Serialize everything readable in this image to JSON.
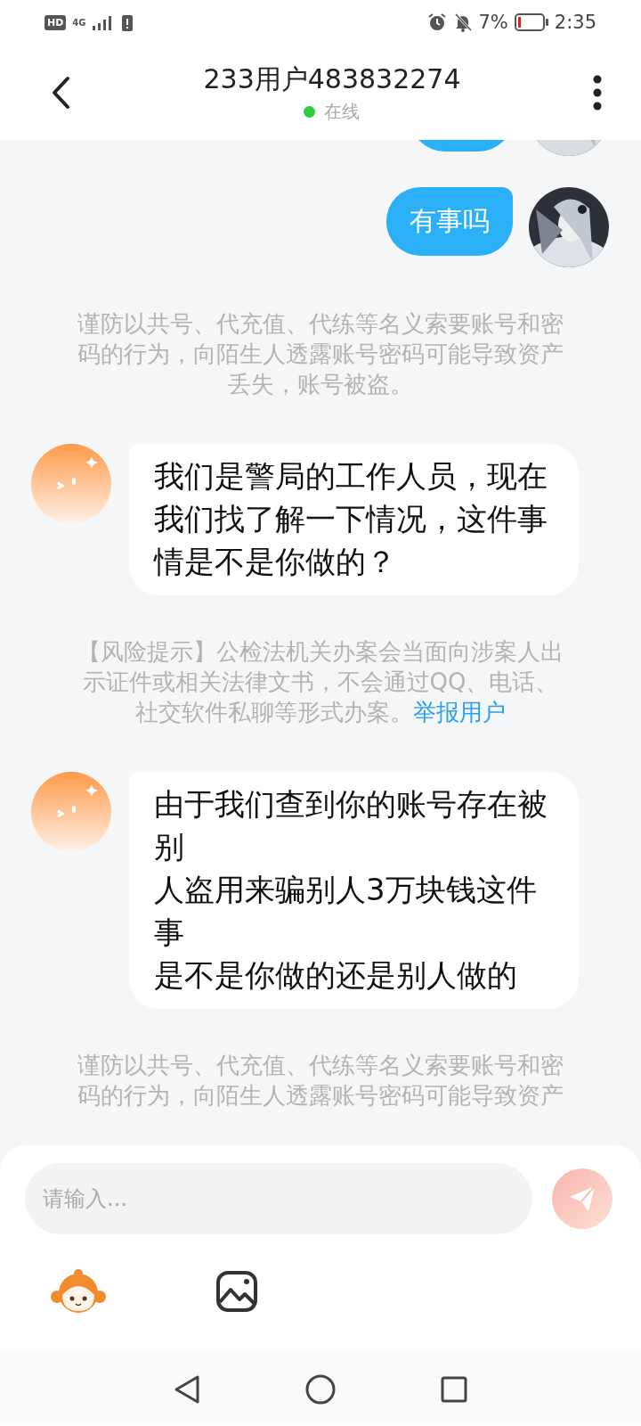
{
  "status_bar": {
    "hd_label": "HD",
    "network": "4G",
    "battery_percent": "7%",
    "time": "2:35"
  },
  "header": {
    "title": "233用户483832274",
    "presence": "在线",
    "online": true
  },
  "messages": [
    {
      "kind": "outgoing_cut"
    },
    {
      "kind": "outgoing",
      "text": "有事吗"
    },
    {
      "kind": "notice",
      "text": "谨防以共号、代充值、代练等名义索要账号和密码的行为，向陌生人透露账号密码可能导致资产丢失，账号被盗。"
    },
    {
      "kind": "incoming",
      "text": "我们是警局的工作人员，现在我们找了解一下情况，这件事情是不是你做的？"
    },
    {
      "kind": "notice",
      "text": "【风险提示】公检法机关办案会当面向涉案人出示证件或相关法律文书，不会通过QQ、电话、社交软件私聊等形式办案。",
      "link": "举报用户"
    },
    {
      "kind": "incoming",
      "lines": [
        "由于我们查到你的账号存在被别",
        "人盗用来骗别人3万块钱这件事",
        "是不是你做的还是别人做的"
      ]
    },
    {
      "kind": "notice",
      "text": "谨防以共号、代充值、代练等名义索要账号和密码的行为，向陌生人透露账号密码可能导致资产"
    }
  ],
  "composer": {
    "placeholder": "请输入..."
  }
}
